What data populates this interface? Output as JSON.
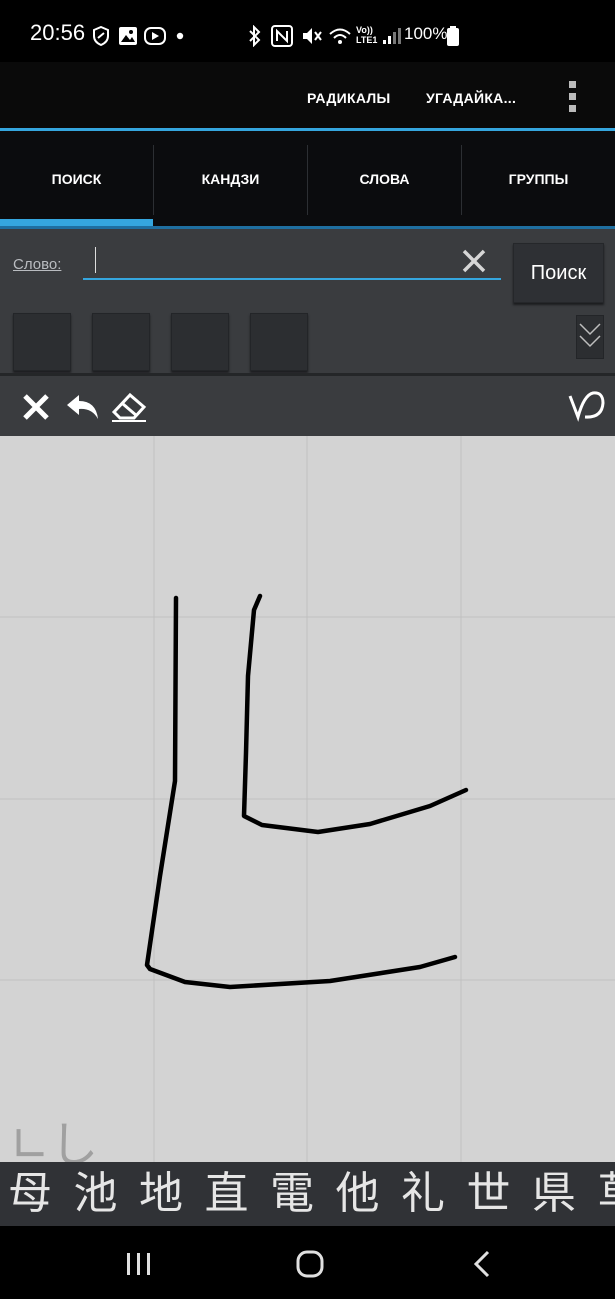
{
  "status_bar": {
    "time": "20:56",
    "battery_text": "100%",
    "network_label_top": "Vo))",
    "network_label_bottom": "LTE1"
  },
  "action_bar": {
    "menu_items": [
      "РАДИКАЛЫ",
      "УГАДАЙКА..."
    ],
    "accent_color": "#35a6de"
  },
  "tabs": [
    {
      "label": "ПОИСК",
      "selected": true
    },
    {
      "label": "КАНДЗИ",
      "selected": false
    },
    {
      "label": "СЛОВА",
      "selected": false
    },
    {
      "label": "ГРУППЫ",
      "selected": false
    }
  ],
  "search": {
    "label": "Слово:",
    "input_value": "",
    "clear_icon": "close-icon",
    "button_label": "Поиск"
  },
  "draw_toolbar": {
    "icons": [
      "close-icon",
      "undo-icon",
      "eraser-icon",
      "stroke-order-icon"
    ]
  },
  "canvas": {
    "hint_text": "∟し"
  },
  "candidates": [
    "母",
    "池",
    "地",
    "直",
    "電",
    "他",
    "礼",
    "世",
    "県",
    "草"
  ],
  "nav_bar": {
    "icons": [
      "recent-apps-icon",
      "home-icon",
      "back-icon"
    ]
  }
}
